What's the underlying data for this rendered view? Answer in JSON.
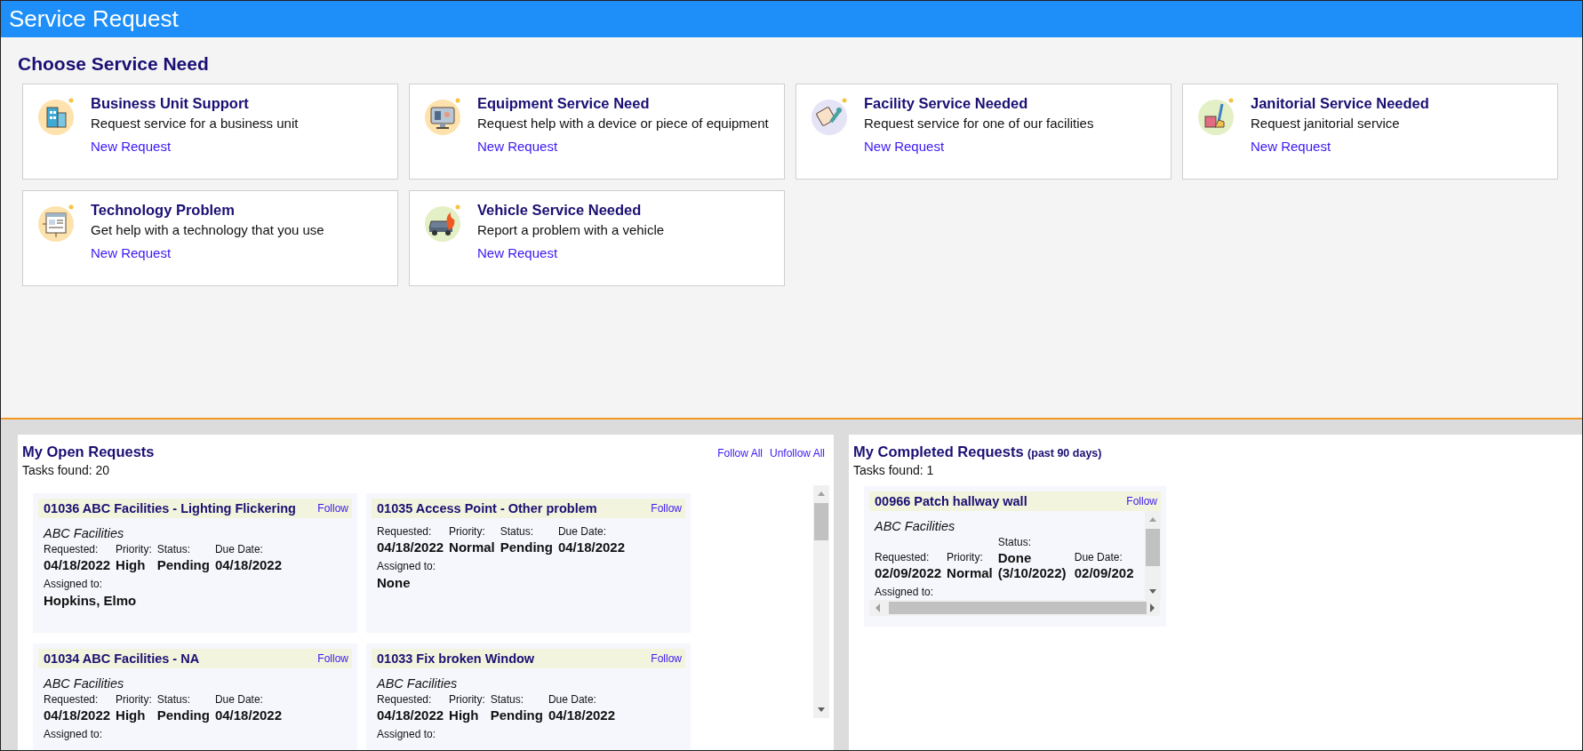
{
  "window": {
    "title": "Service Request"
  },
  "service_section": {
    "heading": "Choose Service Need",
    "services": [
      {
        "title": "Business Unit Support",
        "description": "Request service for a business unit",
        "link": "New Request"
      },
      {
        "title": "Equipment Service Need",
        "description": "Request help with a device or piece of equipment",
        "link": "New Request"
      },
      {
        "title": "Facility Service Needed",
        "description": "Request service for one of our facilities",
        "link": "New Request"
      },
      {
        "title": "Janitorial Service Needed",
        "description": "Request janitorial service",
        "link": "New Request"
      },
      {
        "title": "Technology Problem",
        "description": "Get help with a technology that you use",
        "link": "New Request"
      },
      {
        "title": "Vehicle Service Needed",
        "description": "Report a problem with a vehicle",
        "link": "New Request"
      }
    ]
  },
  "open_requests": {
    "title": "My Open Requests",
    "links": [
      "Follow All",
      "Unfollow All"
    ],
    "count": "Tasks found: 20",
    "requests": [
      {
        "title": "01036 ABC Facilities - Lighting Flickering",
        "follow": "Follow",
        "unit": "ABC Facilities",
        "fields": [
          {
            "label": "Requested:",
            "value": "04/18/2022"
          },
          {
            "label": "Priority:",
            "value": "High"
          },
          {
            "label": "Status:",
            "value": "Pending"
          },
          {
            "label": "Due Date:",
            "value": "04/18/2022"
          }
        ],
        "assigned_label": "Assigned to:",
        "assigned": "Hopkins, Elmo"
      },
      {
        "title": "01035 Access Point - Other problem",
        "follow": "Follow",
        "fields": [
          {
            "label": "Requested:",
            "value": "04/18/2022"
          },
          {
            "label": "Priority:",
            "value": "Normal"
          },
          {
            "label": "Status:",
            "value": "Pending"
          },
          {
            "label": "Due Date:",
            "value": "04/18/2022"
          }
        ],
        "assigned_label": "Assigned to:",
        "assigned": "None"
      },
      {
        "title": "01034 ABC Facilities - NA",
        "follow": "Follow",
        "unit": "ABC Facilities",
        "fields": [
          {
            "label": "Requested:",
            "value": "04/18/2022"
          },
          {
            "label": "Priority:",
            "value": "High"
          },
          {
            "label": "Status:",
            "value": "Pending"
          },
          {
            "label": "Due Date:",
            "value": "04/18/2022"
          }
        ],
        "assigned_label": "Assigned to:"
      },
      {
        "title": "01033 Fix broken Window",
        "follow": "Follow",
        "unit": "ABC Facilities",
        "fields": [
          {
            "label": "Requested:",
            "value": "04/18/2022"
          },
          {
            "label": "Priority:",
            "value": "High"
          },
          {
            "label": "Status:",
            "value": "Pending"
          },
          {
            "label": "Due Date:",
            "value": "04/18/2022"
          }
        ],
        "assigned_label": "Assigned to:"
      }
    ]
  },
  "completed_requests": {
    "title": "My Completed Requests",
    "title_note": "(past 90 days)",
    "count": "Tasks found: 1",
    "requests": [
      {
        "title": "00966 Patch hallway wall",
        "follow": "Follow",
        "unit": "ABC Facilities",
        "fields": [
          {
            "label": "Requested:",
            "value": "02/09/2022"
          },
          {
            "label": "Priority:",
            "value": "Normal"
          },
          {
            "label": "Status:",
            "value": "Done (3/10/2022)"
          },
          {
            "label": "Due Date:",
            "value": "02/09/202"
          }
        ],
        "assigned_label": "Assigned to:"
      }
    ]
  }
}
